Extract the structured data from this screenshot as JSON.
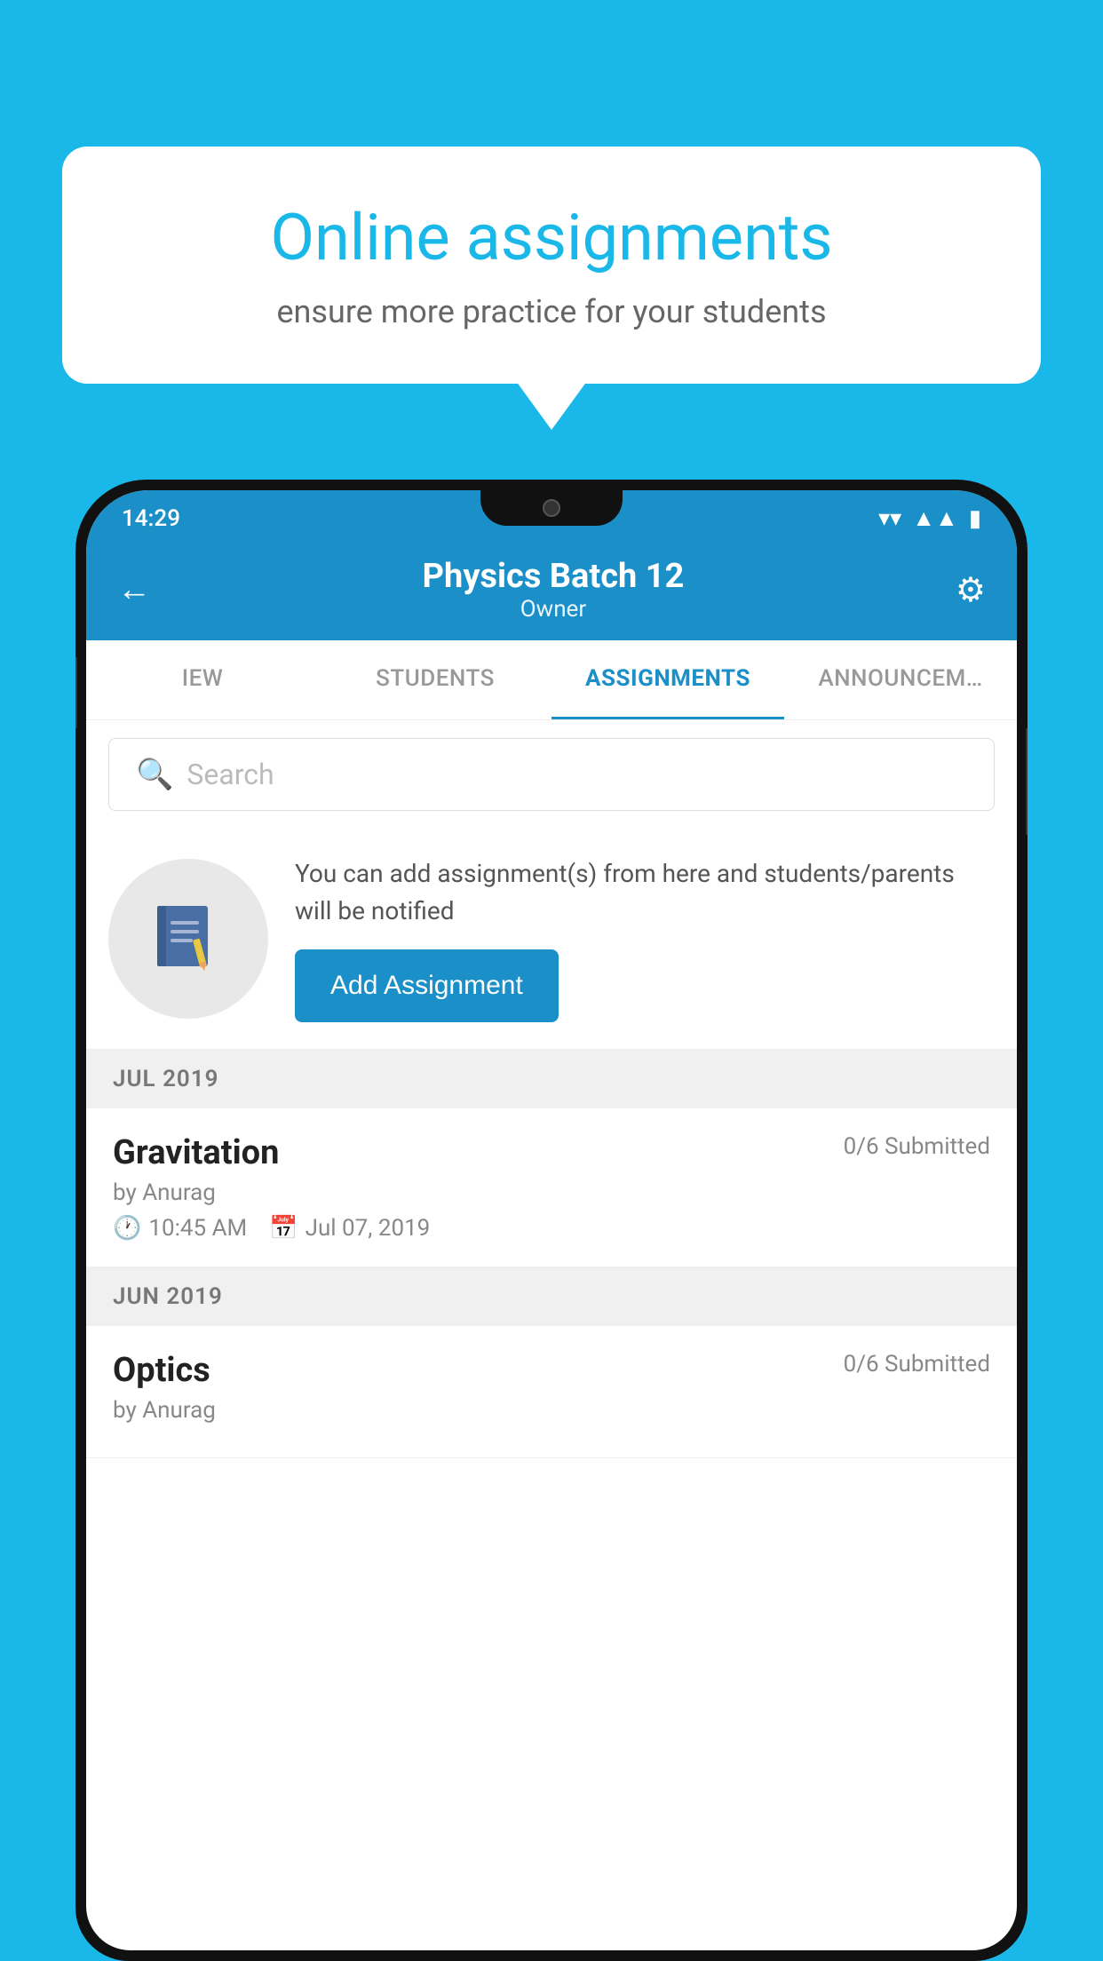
{
  "background_color": "#1ab8e8",
  "speech_bubble": {
    "title": "Online assignments",
    "subtitle": "ensure more practice for your students"
  },
  "status_bar": {
    "time": "14:29",
    "wifi_icon": "wifi",
    "signal_icon": "signal",
    "battery_icon": "battery"
  },
  "header": {
    "back_icon": "←",
    "title": "Physics Batch 12",
    "subtitle": "Owner",
    "settings_icon": "⚙"
  },
  "tabs": [
    {
      "label": "IEW",
      "active": false
    },
    {
      "label": "STUDENTS",
      "active": false
    },
    {
      "label": "ASSIGNMENTS",
      "active": true
    },
    {
      "label": "ANNOUNCEM…",
      "active": false
    }
  ],
  "search": {
    "placeholder": "Search"
  },
  "add_assignment": {
    "description": "You can add assignment(s) from here and students/parents will be notified",
    "button_label": "Add Assignment"
  },
  "sections": [
    {
      "month": "JUL 2019",
      "assignments": [
        {
          "name": "Gravitation",
          "submitted": "0/6 Submitted",
          "author": "by Anurag",
          "time": "10:45 AM",
          "date": "Jul 07, 2019"
        }
      ]
    },
    {
      "month": "JUN 2019",
      "assignments": [
        {
          "name": "Optics",
          "submitted": "0/6 Submitted",
          "author": "by Anurag",
          "time": "",
          "date": ""
        }
      ]
    }
  ]
}
